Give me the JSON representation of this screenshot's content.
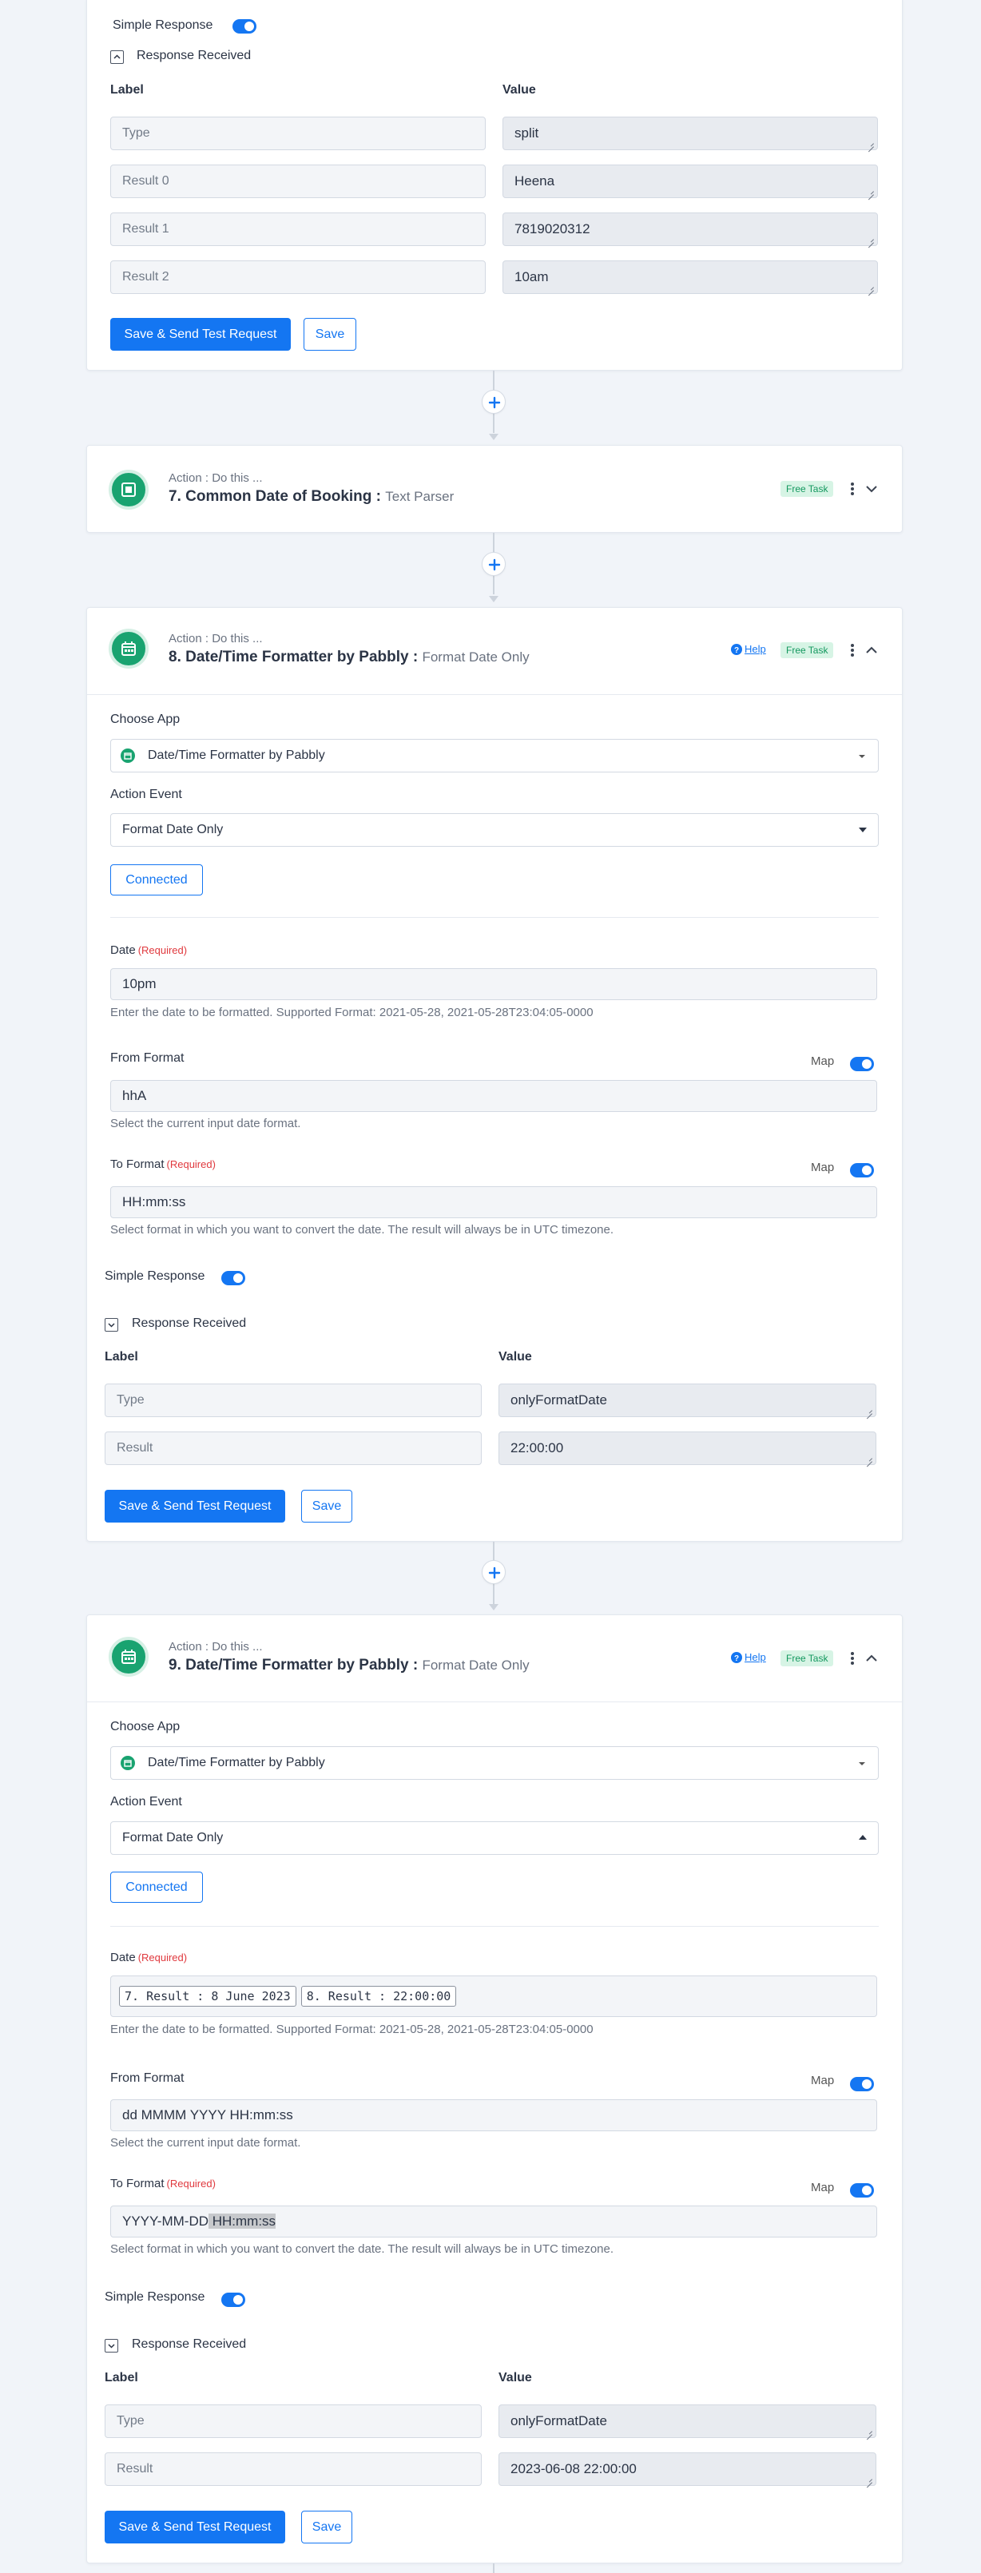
{
  "step6": {
    "simple_response": "Simple Response",
    "response_received": "Response Received",
    "label_header": "Label",
    "value_header": "Value",
    "rows": [
      {
        "label": "Type",
        "value": "split"
      },
      {
        "label": "Result 0",
        "value": "Heena"
      },
      {
        "label": "Result 1",
        "value": "7819020312"
      },
      {
        "label": "Result 2",
        "value": "10am"
      }
    ],
    "save_send": "Save & Send Test Request",
    "save": "Save"
  },
  "step7": {
    "subtitle": "Action : Do this ...",
    "title": "7. Common Date of Booking : ",
    "app": "Text Parser",
    "badge": "Free Task"
  },
  "step8": {
    "subtitle": "Action : Do this ...",
    "title": "8. Date/Time Formatter by Pabbly : ",
    "app": "Format Date Only",
    "help": "Help",
    "badge": "Free Task",
    "choose_app_label": "Choose App",
    "choose_app_value": "Date/Time Formatter by Pabbly",
    "action_event_label": "Action Event",
    "action_event_value": "Format Date Only",
    "connected": "Connected",
    "date_label": "Date",
    "required": "(Required)",
    "date_value": "10pm",
    "date_help": "Enter the date to be formatted. Supported Format: 2021-05-28, 2021-05-28T23:04:05-0000",
    "from_format_label": "From Format",
    "map": "Map",
    "from_format_value": "hhA",
    "from_format_help": "Select the current input date format.",
    "to_format_label": "To Format",
    "to_format_value": "HH:mm:ss",
    "to_format_help": "Select format in which you want to convert the date. The result will always be in UTC timezone.",
    "simple_response": "Simple Response",
    "response_received": "Response Received",
    "label_header": "Label",
    "value_header": "Value",
    "rows": [
      {
        "label": "Type",
        "value": "onlyFormatDate"
      },
      {
        "label": "Result",
        "value": "22:00:00"
      }
    ],
    "save_send": "Save & Send Test Request",
    "save": "Save"
  },
  "step9": {
    "subtitle": "Action : Do this ...",
    "title": "9. Date/Time Formatter by Pabbly : ",
    "app": "Format Date Only",
    "help": "Help",
    "badge": "Free Task",
    "choose_app_label": "Choose App",
    "choose_app_value": "Date/Time Formatter by Pabbly",
    "action_event_label": "Action Event",
    "action_event_value": "Format Date Only",
    "connected": "Connected",
    "date_label": "Date",
    "required": "(Required)",
    "date_chip_1": "7. Result : 8 June 2023",
    "date_chip_2": "8. Result : 22:00:00",
    "date_help": "Enter the date to be formatted. Supported Format: 2021-05-28, 2021-05-28T23:04:05-0000",
    "from_format_label": "From Format",
    "map": "Map",
    "from_format_value": "dd MMMM YYYY HH:mm:ss",
    "from_format_help": "Select the current input date format.",
    "to_format_label": "To Format",
    "to_format_value_a": "YYYY-MM-DD",
    "to_format_value_b": " HH:mm:ss",
    "to_format_help": "Select format in which you want to convert the date. The result will always be in UTC timezone.",
    "simple_response": "Simple Response",
    "response_received": "Response Received",
    "label_header": "Label",
    "value_header": "Value",
    "rows": [
      {
        "label": "Type",
        "value": "onlyFormatDate"
      },
      {
        "label": "Result",
        "value": "2023-06-08 22:00:00"
      }
    ],
    "save_send": "Save & Send Test Request",
    "save": "Save"
  },
  "colors": {
    "accent": "#1476f2",
    "app_green": "#19a370",
    "badge_bg": "#d7f4e5",
    "required": "#e0393e",
    "page_bg": "#f1f4f9"
  }
}
